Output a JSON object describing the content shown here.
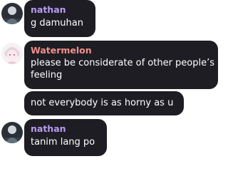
{
  "messages": [
    {
      "author": "nathan",
      "author_color": "#b79cf0",
      "avatar": "nathan-avatar-icon",
      "lines": [
        "g damuhan"
      ]
    },
    {
      "author": "Watermelon",
      "author_color": "#f0908a",
      "avatar": "watermelon-avatar-icon",
      "lines": [
        "please be considerate of other people’s",
        "feeling"
      ]
    },
    {
      "author": "",
      "lines": [
        "not everybody is as horny as u"
      ]
    },
    {
      "author": "nathan",
      "author_color": "#b79cf0",
      "avatar": "nathan-avatar-icon",
      "lines": [
        "tanim lang po"
      ]
    }
  ],
  "colors": {
    "bubble": "#1e1d24",
    "message_text": "#ffffff",
    "background": "#ffffff"
  }
}
